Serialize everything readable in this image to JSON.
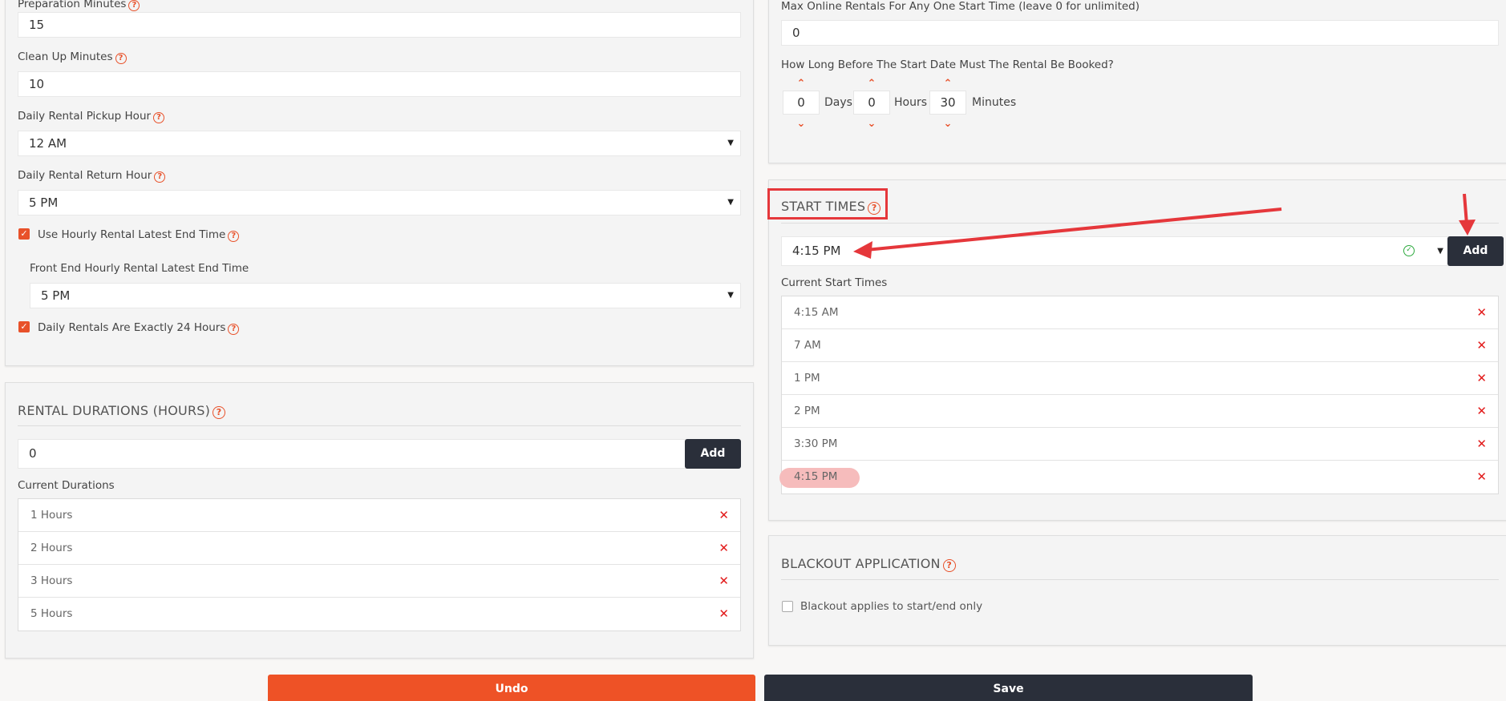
{
  "left_settings": {
    "prep_label": "Preparation Minutes",
    "prep_value": "15",
    "cleanup_label": "Clean Up Minutes",
    "cleanup_value": "10",
    "pickup_label": "Daily Rental Pickup Hour",
    "pickup_value": "12 AM",
    "return_label": "Daily Rental Return Hour",
    "return_value": "5 PM",
    "hourly_latest_label": "Use Hourly Rental Latest End Time",
    "hourly_latest_checked": true,
    "frontend_latest_label": "Front End Hourly Rental Latest End Time",
    "frontend_latest_value": "5 PM",
    "exact24_label": "Daily Rentals Are Exactly 24 Hours",
    "exact24_checked": true
  },
  "durations": {
    "title": "RENTAL DURATIONS (HOURS)",
    "input_value": "0",
    "add_label": "Add",
    "current_label": "Current Durations",
    "items": [
      "1 Hours",
      "2 Hours",
      "3 Hours",
      "5 Hours"
    ],
    "remove_glyph": "✕"
  },
  "online": {
    "max_label": "Max Online Rentals For Any One Start Time (leave 0 for unlimited)",
    "max_value": "0",
    "before_label": "How Long Before The Start Date Must The Rental Be Booked?",
    "days_value": "0",
    "days_unit": "Days",
    "hours_value": "0",
    "hours_unit": "Hours",
    "minutes_value": "30",
    "minutes_unit": "Minutes"
  },
  "start_times": {
    "title": "START TIMES",
    "select_value": "4:15 PM",
    "add_label": "Add",
    "current_label": "Current Start Times",
    "items": [
      "4:15 AM",
      "7 AM",
      "1 PM",
      "2 PM",
      "3:30 PM",
      "4:15 PM"
    ],
    "remove_glyph": "✕"
  },
  "blackout": {
    "title": "BLACKOUT APPLICATION",
    "checkbox_label": "Blackout applies to start/end only",
    "checked": false
  },
  "actions": {
    "undo_label": "Undo",
    "save_label": "Save"
  },
  "colors": {
    "accent": "#e8512a",
    "dark": "#2a2f3a",
    "annotation_red": "#e5373b",
    "remove_red": "#e21b1b"
  }
}
